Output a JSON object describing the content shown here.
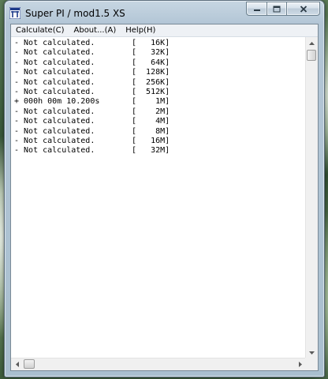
{
  "window": {
    "title": "Super PI / mod1.5 XS",
    "app_icon": "super-pi-app-icon"
  },
  "menu": [
    {
      "label": "Calculate(C)"
    },
    {
      "label": "About...(A)"
    },
    {
      "label": "Help(H)"
    }
  ],
  "log": [
    {
      "status": "- Not calculated.",
      "size": "[   16K]"
    },
    {
      "status": "- Not calculated.",
      "size": "[   32K]"
    },
    {
      "status": "- Not calculated.",
      "size": "[   64K]"
    },
    {
      "status": "- Not calculated.",
      "size": "[  128K]"
    },
    {
      "status": "- Not calculated.",
      "size": "[  256K]"
    },
    {
      "status": "- Not calculated.",
      "size": "[  512K]"
    },
    {
      "status": "+ 000h 00m 10.200s",
      "size": "[    1M]"
    },
    {
      "status": "- Not calculated.",
      "size": "[    2M]"
    },
    {
      "status": "- Not calculated.",
      "size": "[    4M]"
    },
    {
      "status": "- Not calculated.",
      "size": "[    8M]"
    },
    {
      "status": "- Not calculated.",
      "size": "[   16M]"
    },
    {
      "status": "- Not calculated.",
      "size": "[   32M]"
    }
  ],
  "icons": {
    "minimize": "minimize-icon",
    "maximize": "maximize-icon",
    "close": "close-icon",
    "scroll_up": "arrow-up-icon",
    "scroll_down": "arrow-down-icon",
    "scroll_left": "arrow-left-icon",
    "scroll_right": "arrow-right-icon"
  },
  "colors": {
    "text": "#000000",
    "client_background": "#ffffff",
    "menubar_background": "#eef1f5",
    "frame": "#b3c6d6"
  }
}
